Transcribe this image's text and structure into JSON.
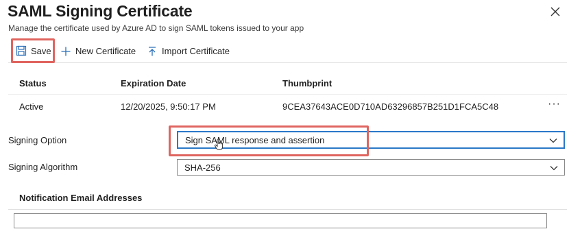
{
  "header": {
    "title": "SAML Signing Certificate",
    "subtitle": "Manage the certificate used by Azure AD to sign SAML tokens issued to your app",
    "close_icon": "close-icon"
  },
  "toolbar": {
    "save_label": "Save",
    "new_certificate_label": "New Certificate",
    "import_certificate_label": "Import Certificate"
  },
  "certificates": {
    "columns": [
      "Status",
      "Expiration Date",
      "Thumbprint"
    ],
    "rows": [
      {
        "status": "Active",
        "expiration": "12/20/2025, 9:50:17 PM",
        "thumbprint": "9CEA37643ACE0D710AD63296857B251D1FCA5C48",
        "more": "···"
      }
    ]
  },
  "signing_option": {
    "label": "Signing Option",
    "value": "Sign SAML response and assertion"
  },
  "signing_algorithm": {
    "label": "Signing Algorithm",
    "value": "SHA-256"
  },
  "notification": {
    "label": "Notification Email Addresses",
    "value": ""
  },
  "colors": {
    "accent": "#2a78c8",
    "highlight": "#e0645f",
    "icon_blue": "#2a6fb8"
  }
}
